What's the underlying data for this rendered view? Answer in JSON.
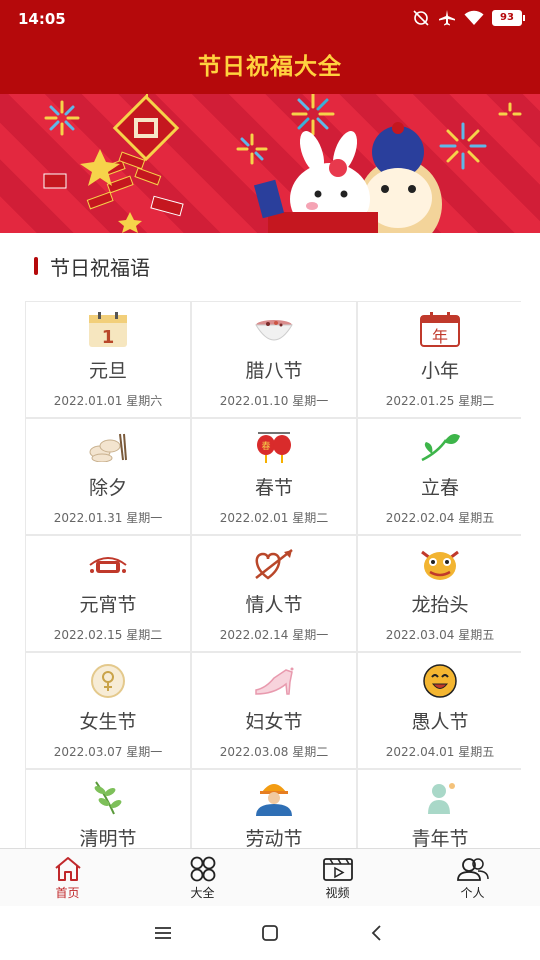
{
  "status": {
    "time": "14:05",
    "battery": "93"
  },
  "app": {
    "title": "节日祝福大全"
  },
  "section": {
    "title": "节日祝福语"
  },
  "holidays": [
    {
      "name": "元旦",
      "date": "2022.01.01 星期六",
      "icon": "calendar-icon"
    },
    {
      "name": "腊八节",
      "date": "2022.01.10 星期一",
      "icon": "porridge-bowl-icon"
    },
    {
      "name": "小年",
      "date": "2022.01.25 星期二",
      "icon": "calendar-year-icon"
    },
    {
      "name": "除夕",
      "date": "2022.01.31 星期一",
      "icon": "dumplings-icon"
    },
    {
      "name": "春节",
      "date": "2022.02.01 星期二",
      "icon": "lantern-icon"
    },
    {
      "name": "立春",
      "date": "2022.02.04 星期五",
      "icon": "sprout-icon"
    },
    {
      "name": "元宵节",
      "date": "2022.02.15 星期二",
      "icon": "lantern-festival-logo-icon"
    },
    {
      "name": "情人节",
      "date": "2022.02.14 星期一",
      "icon": "heart-arrow-icon"
    },
    {
      "name": "龙抬头",
      "date": "2022.03.04 星期五",
      "icon": "dragon-icon"
    },
    {
      "name": "女生节",
      "date": "2022.03.07 星期一",
      "icon": "female-symbol-icon"
    },
    {
      "name": "妇女节",
      "date": "2022.03.08 星期二",
      "icon": "high-heel-icon"
    },
    {
      "name": "愚人节",
      "date": "2022.04.01 星期五",
      "icon": "smiley-icon"
    },
    {
      "name": "清明节",
      "date": "",
      "icon": "willow-branch-icon"
    },
    {
      "name": "劳动节",
      "date": "",
      "icon": "worker-icon"
    },
    {
      "name": "青年节",
      "date": "",
      "icon": "youth-icon"
    }
  ],
  "tabs": [
    {
      "label": "首页",
      "icon": "home-icon",
      "active": true
    },
    {
      "label": "大全",
      "icon": "grid-icon",
      "active": false
    },
    {
      "label": "视频",
      "icon": "video-icon",
      "active": false
    },
    {
      "label": "个人",
      "icon": "user-icon",
      "active": false
    }
  ],
  "colors": {
    "primary": "#b5090b",
    "title": "#ffd23f",
    "active_tab": "#c0282b"
  }
}
